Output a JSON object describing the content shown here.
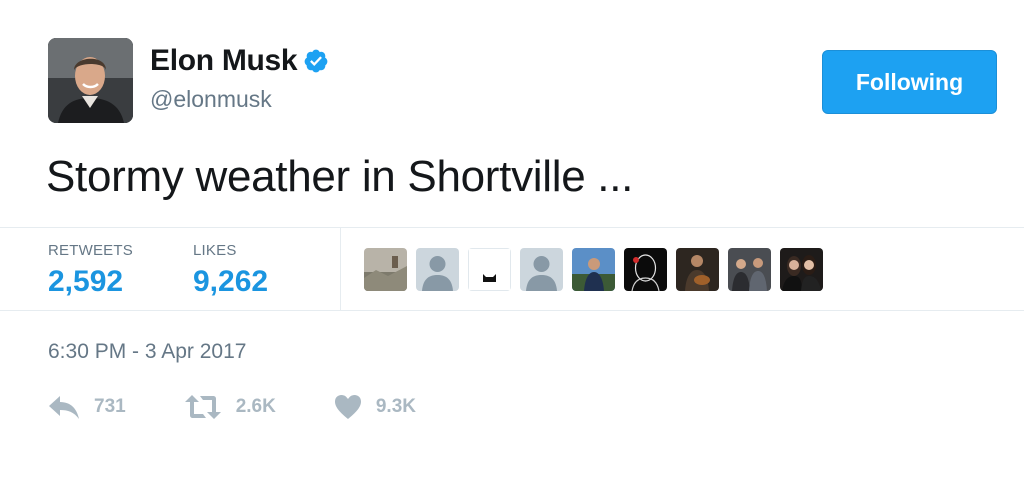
{
  "author": {
    "display_name": "Elon Musk",
    "handle": "@elonmusk",
    "verified": true,
    "verified_icon": "verified-badge-icon"
  },
  "follow_button": {
    "label": "Following"
  },
  "tweet": {
    "text": "Stormy weather in Shortville ..."
  },
  "stats": {
    "retweets": {
      "label": "RETWEETS",
      "value": "2,592"
    },
    "likes": {
      "label": "LIKES",
      "value": "9,262"
    }
  },
  "liked_by_avatars": [
    "landscape-photo-avatar",
    "default-profile-avatar",
    "black-cat-avatar",
    "default-profile-avatar",
    "person-outdoors-avatar",
    "neon-portrait-avatar",
    "guitarist-avatar",
    "group-photo-avatar",
    "two-women-avatar"
  ],
  "timestamp": "6:30 PM - 3 Apr 2017",
  "actions": {
    "reply": {
      "icon": "reply-icon",
      "count": "731"
    },
    "retweet": {
      "icon": "retweet-icon",
      "count": "2.6K"
    },
    "like": {
      "icon": "heart-icon",
      "count": "9.3K"
    }
  },
  "colors": {
    "accent": "#1da1f2",
    "link_blue": "#1b95e0",
    "secondary_text": "#657786",
    "action_gray": "#aab8c2",
    "border": "#e6ecf0"
  }
}
